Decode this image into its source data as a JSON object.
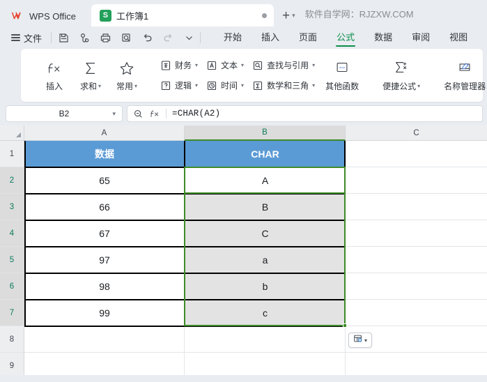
{
  "titlebar": {
    "brand": "WPS Office",
    "brand_logo_icon": "wps-w-logo-icon",
    "tab": {
      "icon": "spreadsheet-s-icon",
      "icon_letter": "S",
      "label": "工作簿1",
      "modified_dot": "unsaved-dot-icon"
    },
    "new_tab_icon": "plus-icon",
    "new_tab_caret": "chevron-down-icon",
    "promo_text": "软件自学网：RJZXW.COM"
  },
  "menubar": {
    "hamburger_icon": "hamburger-menu-icon",
    "file_label": "文件",
    "quick_access": [
      {
        "name": "save-icon",
        "label": "保存"
      },
      {
        "name": "share-icon",
        "label": "分享"
      },
      {
        "name": "print-icon",
        "label": "打印"
      },
      {
        "name": "print-preview-icon",
        "label": "打印预览"
      },
      {
        "name": "undo-icon",
        "label": "撤销"
      },
      {
        "name": "redo-icon",
        "label": "恢复"
      },
      {
        "name": "qat-more-icon",
        "label": "更多"
      }
    ],
    "tabs": [
      {
        "label": "开始",
        "active": false
      },
      {
        "label": "插入",
        "active": false
      },
      {
        "label": "页面",
        "active": false
      },
      {
        "label": "公式",
        "active": true
      },
      {
        "label": "数据",
        "active": false
      },
      {
        "label": "审阅",
        "active": false
      },
      {
        "label": "视图",
        "active": false
      }
    ]
  },
  "ribbon": {
    "group1": [
      {
        "label": "插入",
        "icon": "fx-icon",
        "caret": false
      },
      {
        "label": "求和",
        "icon": "sigma-icon",
        "caret": true
      },
      {
        "label": "常用",
        "icon": "star-icon",
        "caret": true
      }
    ],
    "group2_row1": [
      {
        "label": "财务",
        "icon": "finance-icon",
        "caret": true
      },
      {
        "label": "文本",
        "icon": "text-a-icon",
        "caret": true
      },
      {
        "label": "查找与引用",
        "icon": "lookup-icon",
        "caret": true
      }
    ],
    "group2_row2": [
      {
        "label": "逻辑",
        "icon": "logic-question-icon",
        "caret": true
      },
      {
        "label": "时间",
        "icon": "clock-icon",
        "caret": true
      },
      {
        "label": "数学和三角",
        "icon": "math-icon",
        "caret": true
      }
    ],
    "other_functions": {
      "label": "其他函数",
      "icon": "more-functions-icon",
      "caret": false
    },
    "convenient": {
      "label": "便捷公式",
      "icon": "sigma-plus-icon",
      "caret": true
    },
    "name_manager": {
      "label": "名称管理器",
      "icon": "name-manager-icon",
      "caret": false
    }
  },
  "formulabar": {
    "namebox_value": "B2",
    "namebox_caret": "chevron-down-icon",
    "zoom_icon": "magnifier-minus-icon",
    "fx_icon": "fx-icon",
    "formula": "=CHAR(A2)"
  },
  "grid": {
    "select_all_icon": "select-all-corner-icon",
    "columns": [
      {
        "label": "A",
        "selected": false
      },
      {
        "label": "B",
        "selected": true
      },
      {
        "label": "C",
        "selected": false
      }
    ],
    "rows": [
      {
        "label": "1",
        "selected": false
      },
      {
        "label": "2",
        "selected": true
      },
      {
        "label": "3",
        "selected": true
      },
      {
        "label": "4",
        "selected": true
      },
      {
        "label": "5",
        "selected": true
      },
      {
        "label": "6",
        "selected": true
      },
      {
        "label": "7",
        "selected": true
      },
      {
        "label": "8",
        "selected": false
      },
      {
        "label": "9",
        "selected": false
      }
    ],
    "table": {
      "header": [
        "数据",
        "CHAR"
      ],
      "data": [
        [
          "65",
          "A"
        ],
        [
          "66",
          "B"
        ],
        [
          "67",
          "C"
        ],
        [
          "97",
          "a"
        ],
        [
          "98",
          "b"
        ],
        [
          "99",
          "c"
        ]
      ]
    },
    "active_cell": "B2",
    "selected_range": "B2:B7",
    "autofill_button": {
      "icon": "autofill-options-icon",
      "caret": "chevron-down-icon"
    },
    "colors": {
      "header_blue": "#5b9bd5",
      "selection_green": "#3d8b27",
      "shaded_cell": "#e3e3e3",
      "header_gray": "#eceef0"
    }
  }
}
